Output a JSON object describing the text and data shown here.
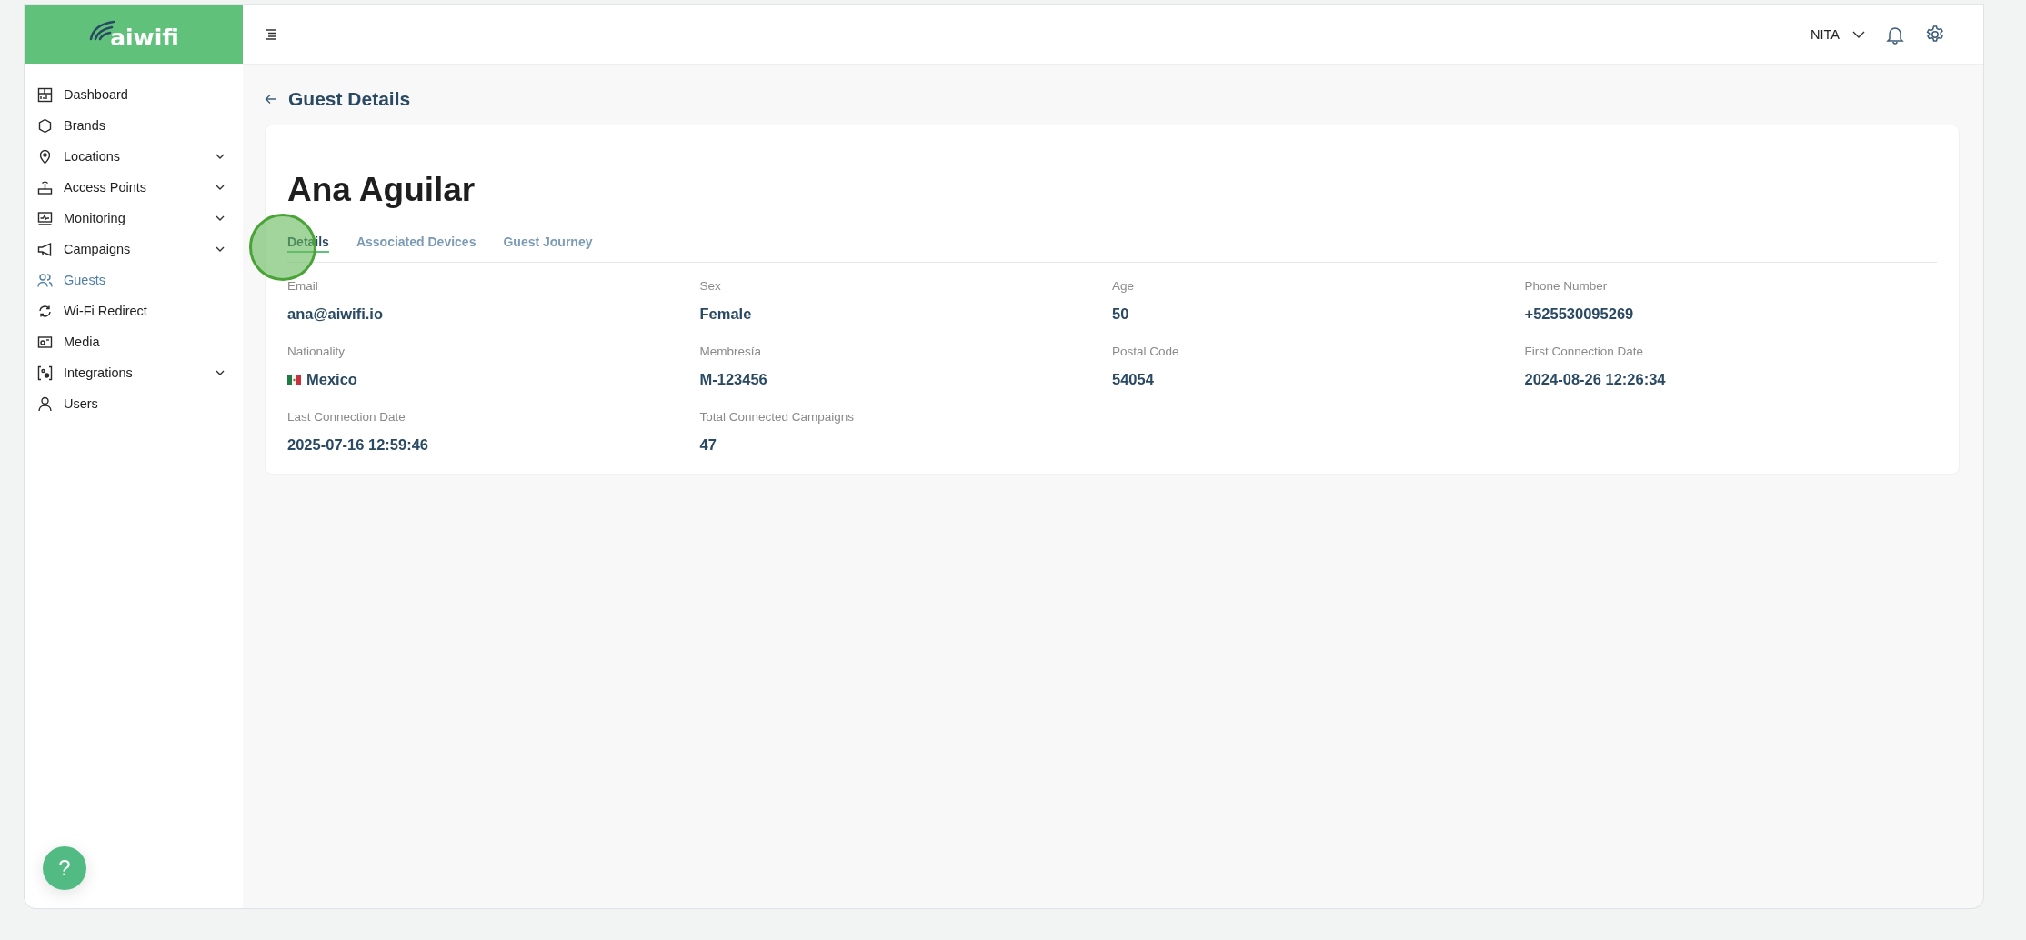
{
  "logo": "aiwifi",
  "sidebar": {
    "items": [
      {
        "label": "Dashboard",
        "expandable": false,
        "selected": false
      },
      {
        "label": "Brands",
        "expandable": false,
        "selected": false
      },
      {
        "label": "Locations",
        "expandable": true,
        "selected": false
      },
      {
        "label": "Access Points",
        "expandable": true,
        "selected": false
      },
      {
        "label": "Monitoring",
        "expandable": true,
        "selected": false
      },
      {
        "label": "Campaigns",
        "expandable": true,
        "selected": false
      },
      {
        "label": "Guests",
        "expandable": false,
        "selected": true
      },
      {
        "label": "Wi-Fi Redirect",
        "expandable": false,
        "selected": false
      },
      {
        "label": "Media",
        "expandable": false,
        "selected": false
      },
      {
        "label": "Integrations",
        "expandable": true,
        "selected": false
      },
      {
        "label": "Users",
        "expandable": false,
        "selected": false
      }
    ]
  },
  "topbar": {
    "user": "NITA"
  },
  "page_title": "Guest Details",
  "guest_name": "Ana Aguilar",
  "tabs": [
    {
      "label": "Details",
      "selected": true
    },
    {
      "label": "Associated Devices",
      "selected": false
    },
    {
      "label": "Guest Journey",
      "selected": false
    }
  ],
  "fields": [
    {
      "label": "Email",
      "value": "ana@aiwifi.io"
    },
    {
      "label": "Sex",
      "value": "Female"
    },
    {
      "label": "Age",
      "value": "50"
    },
    {
      "label": "Phone Number",
      "value": "+525530095269"
    },
    {
      "label": "Nationality",
      "value": "Mexico",
      "kind": "country"
    },
    {
      "label": "Membresía",
      "value": "M-123456"
    },
    {
      "label": "Postal Code",
      "value": "54054"
    },
    {
      "label": "First Connection Date",
      "value": "2024-08-26 12:26:34"
    },
    {
      "label": "Last Connection Date",
      "value": "2025-07-16 12:59:46"
    },
    {
      "label": "Total Connected Campaigns",
      "value": "47"
    }
  ],
  "help_button": "?"
}
